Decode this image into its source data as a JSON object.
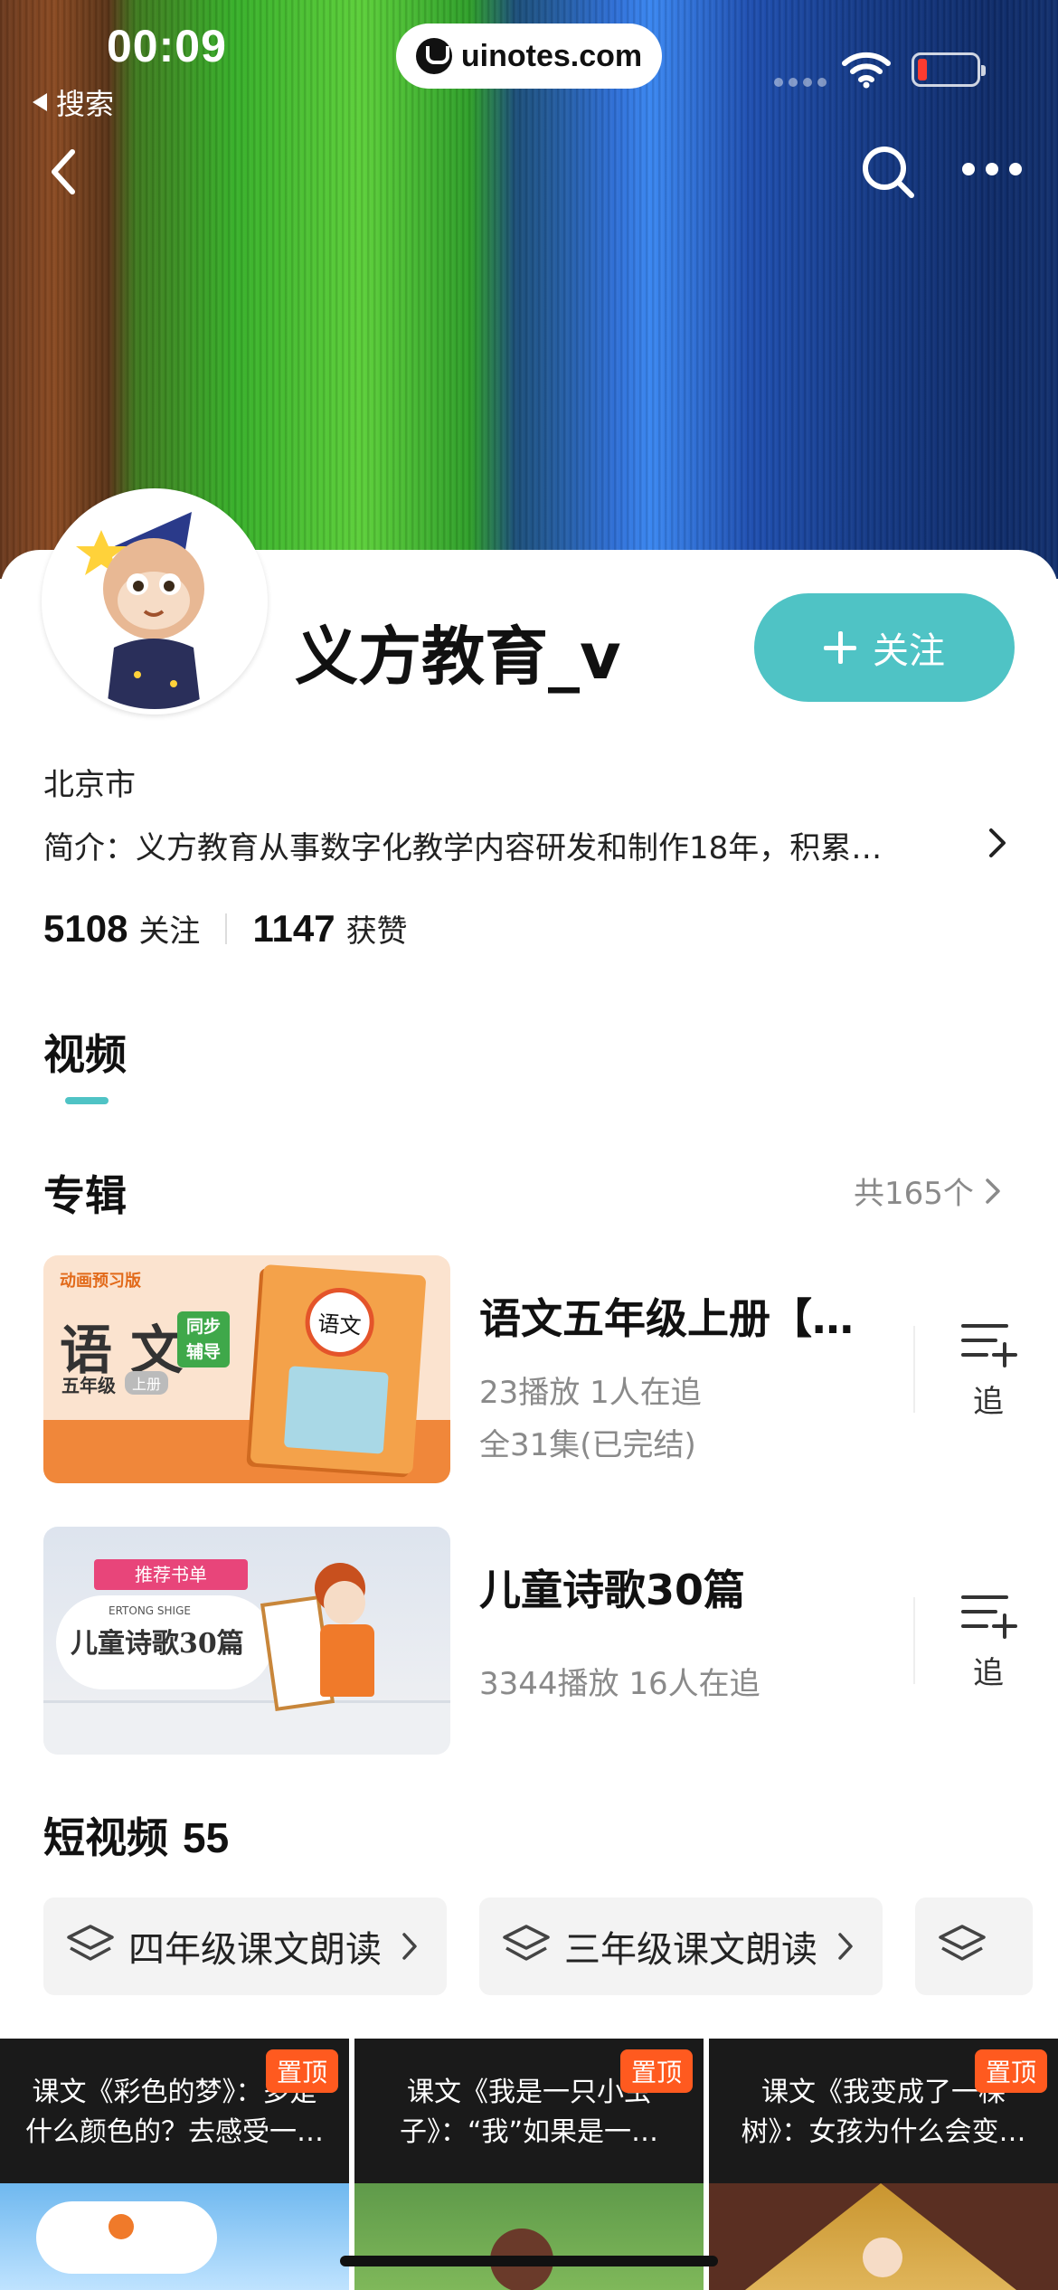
{
  "status_bar": {
    "time": "00:09",
    "back_app": "搜索",
    "url": "uinotes.com"
  },
  "profile": {
    "name": "义方教育_v",
    "follow_label": "关注",
    "location": "北京市",
    "bio": "简介：义方教育从事数字化教学内容研发和制作18年，积累…",
    "following_count": "5108",
    "following_label": "关注",
    "likes_count": "1147",
    "likes_label": "获赞"
  },
  "tabs": {
    "active": "视频"
  },
  "albums_section": {
    "title": "专辑",
    "count_label": "共165个",
    "items": [
      {
        "title": "语文五年级上册【…",
        "stats": "23播放  1人在追",
        "episodes": "全31集(已完结)",
        "track_label": "追",
        "thumb": {
          "tag": "动画预习版",
          "big": "语 文",
          "grade": "五年级",
          "vol": "上册",
          "badge1": "同步",
          "badge2": "辅导",
          "book": "语文"
        }
      },
      {
        "title": "儿童诗歌30篇",
        "stats": "3344播放  16人在追",
        "episodes": "",
        "track_label": "追",
        "thumb": {
          "ribbon": "推荐书单",
          "en": "ERTONG SHIGE",
          "big": "儿童诗歌30篇"
        }
      }
    ]
  },
  "short_videos": {
    "title": "短视频",
    "count": "55",
    "chips": [
      {
        "label": "四年级课文朗读"
      },
      {
        "label": "三年级课文朗读"
      },
      {
        "label": ""
      }
    ],
    "tiles": [
      {
        "caption": "课文《彩色的梦》：多是什么颜色的？去感受一…",
        "pin": "置顶"
      },
      {
        "caption": "课文《我是一只小虫子》：“我”如果是一…",
        "pin": "置顶"
      },
      {
        "caption": "课文《我变成了一棵树》：女孩为什么会变…",
        "pin": "置顶"
      }
    ]
  },
  "colors": {
    "accent": "#4fc3c5",
    "pin": "#ff5a1f",
    "muted": "#8a8a8a"
  }
}
